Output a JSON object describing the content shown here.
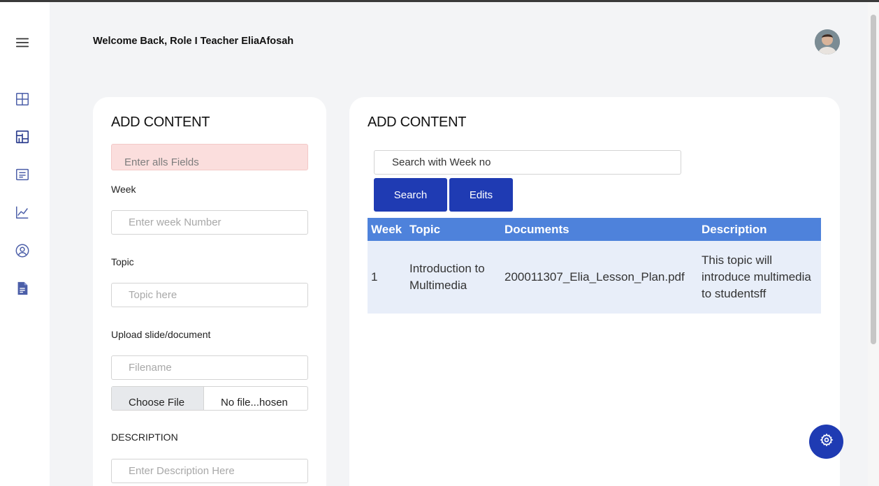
{
  "header": {
    "welcome_text": "Welcome Back, Role I Teacher EliaAfosah"
  },
  "sidebar": {
    "items": [
      {
        "icon": "menu-icon"
      },
      {
        "icon": "dashboard-grid-icon"
      },
      {
        "icon": "layout-icon"
      },
      {
        "icon": "document-list-icon"
      },
      {
        "icon": "chart-line-icon"
      },
      {
        "icon": "user-circle-icon"
      },
      {
        "icon": "file-text-icon"
      }
    ]
  },
  "left_panel": {
    "title": "ADD CONTENT",
    "alert_text": "Enter alls Fields",
    "week_label": "Week",
    "week_placeholder": "Enter week Number",
    "topic_label": "Topic",
    "topic_placeholder": "Topic here",
    "upload_label": "Upload slide/document",
    "filename_placeholder": "Filename",
    "choose_file_label": "Choose File",
    "no_file_text": "No file...hosen",
    "description_label": "DESCRIPTION",
    "description_placeholder": "Enter Description Here"
  },
  "right_panel": {
    "title": "ADD CONTENT",
    "search_value": "Search with Week no",
    "search_button": "Search",
    "edits_button": "Edits",
    "table": {
      "headers": [
        "Week",
        "Topic",
        "Documents",
        "Description"
      ],
      "rows": [
        [
          "1",
          "Introduction to Multimedia",
          "200011307_Elia_Lesson_Plan.pdf",
          "This topic will introduce multimedia to studentsff"
        ]
      ]
    }
  },
  "colors": {
    "primary": "#1f3bb3",
    "table_header": "#4e82db",
    "table_row": "#e8eef9",
    "alert_bg": "#fbdedd",
    "sidebar_icon": "#4b5ea8"
  },
  "fab": {
    "icon": "settings-gear-icon"
  }
}
